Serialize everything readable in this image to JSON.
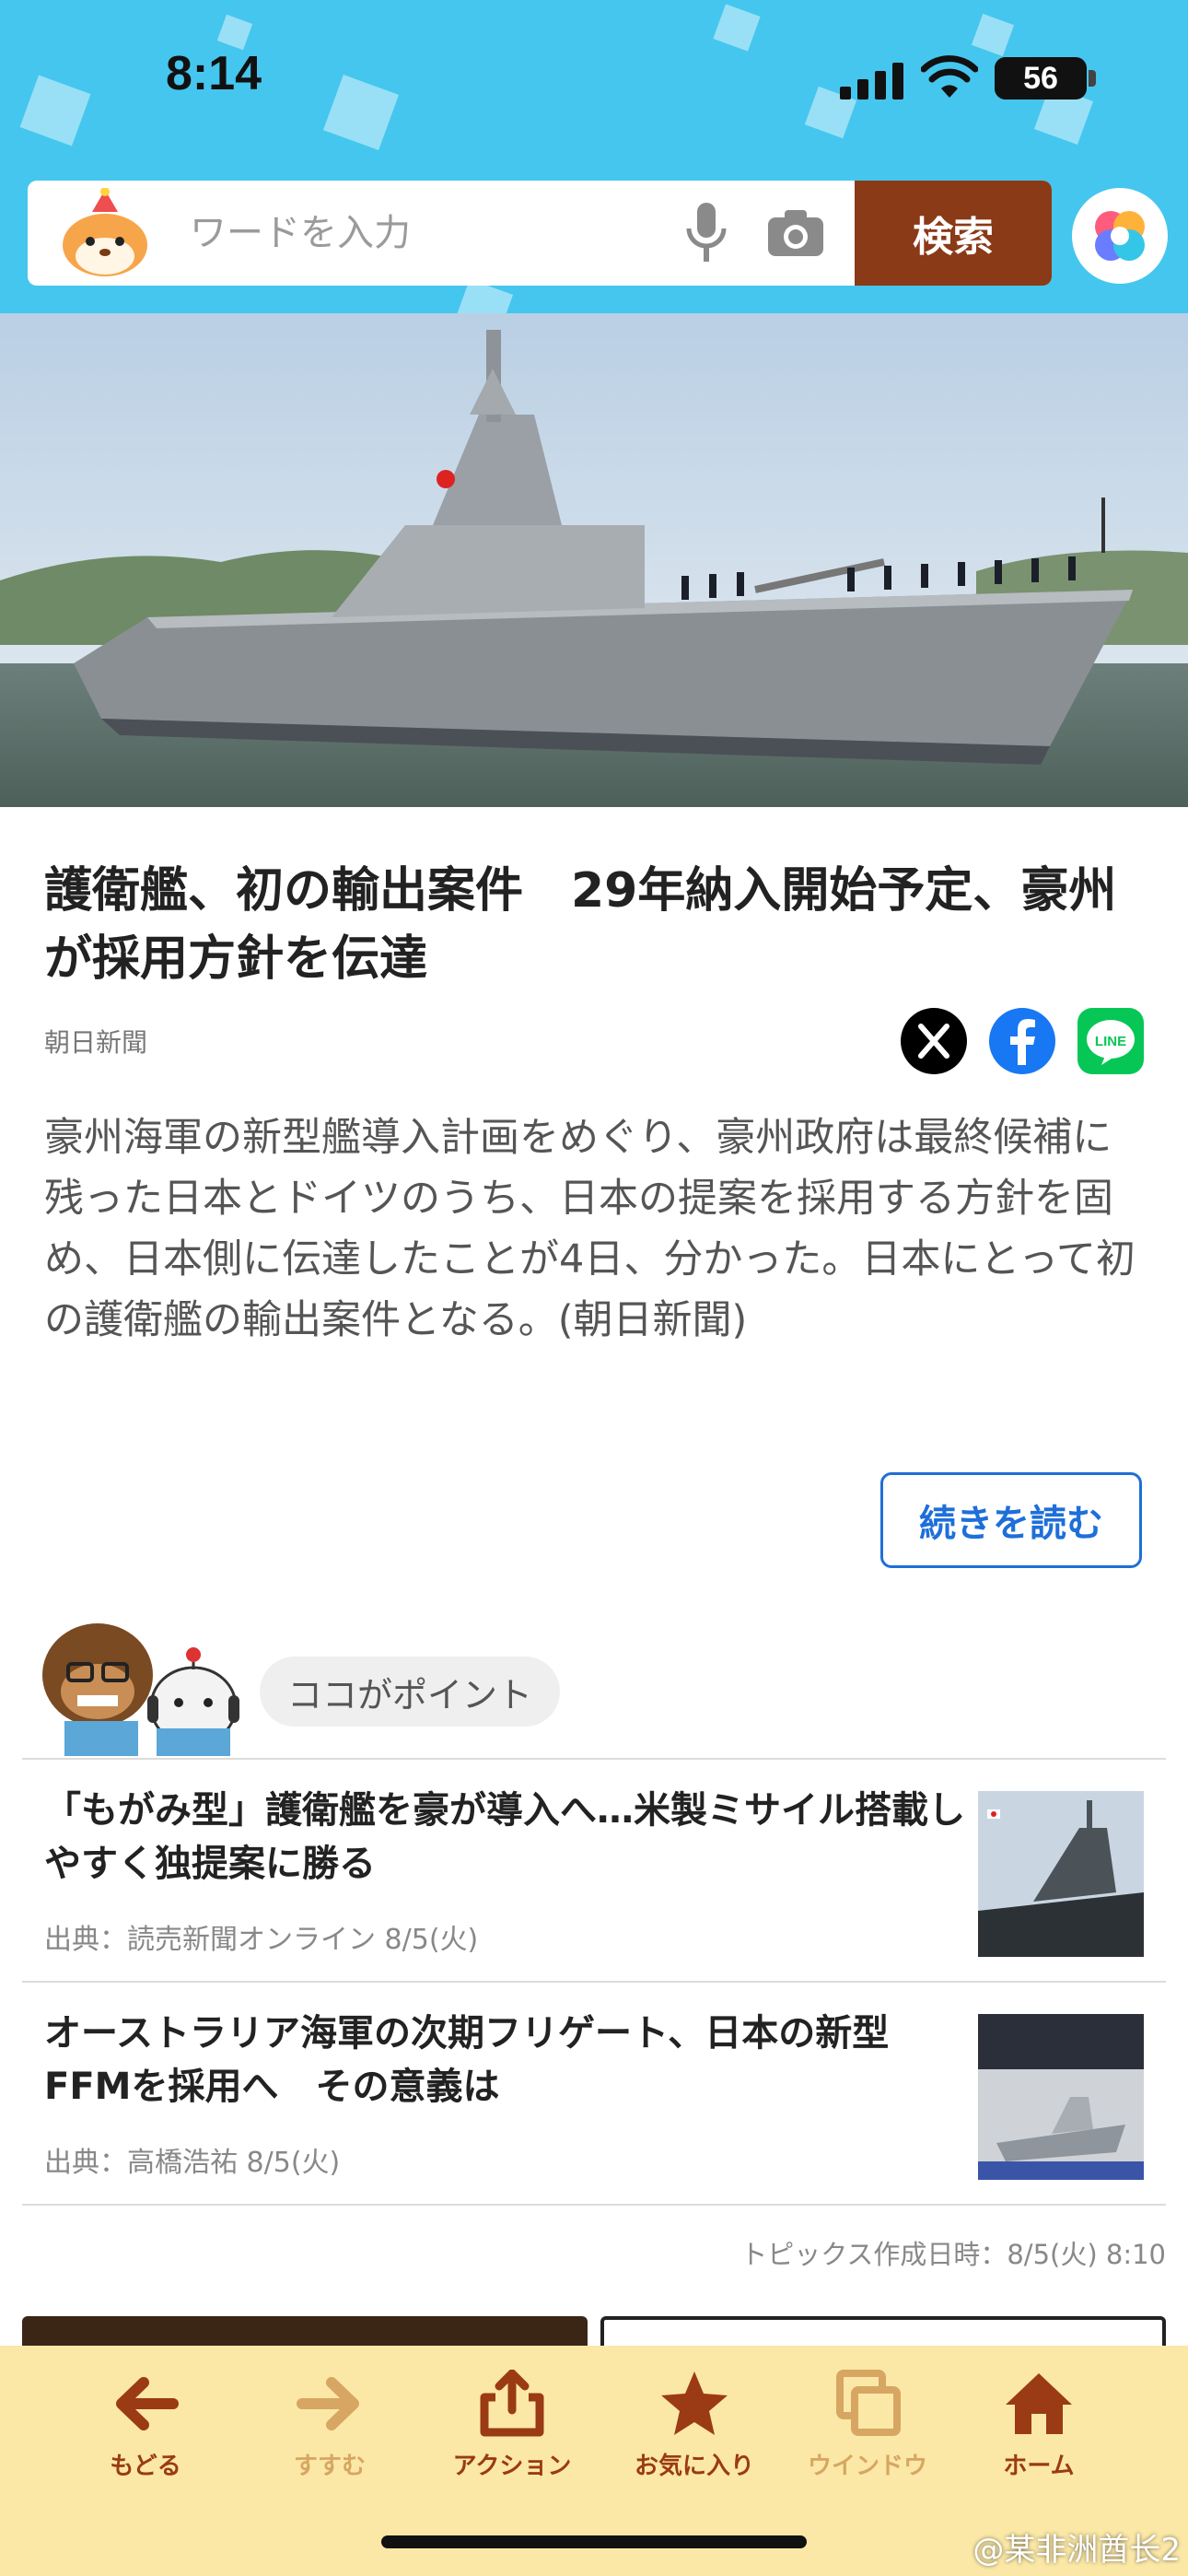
{
  "status_bar": {
    "time": "8:14",
    "battery": "56",
    "icons": [
      "signal-icon",
      "wifi-icon",
      "battery-icon"
    ]
  },
  "search": {
    "placeholder": "ワードを入力",
    "button_label": "検索",
    "icons": [
      "mascot-icon",
      "mic-icon",
      "camera-icon",
      "assistant-icon"
    ]
  },
  "article": {
    "title": "護衛艦、初の輸出案件　29年納入開始予定、豪州が採用方針を伝達",
    "source": "朝日新聞",
    "summary": "豪州海軍の新型艦導入計画をめぐり、豪州政府は最終候補に残った日本とドイツのうち、日本の提案を採用する方針を固め、日本側に伝達したことが4日、分かった。日本にとって初の護衛艦の輸出案件となる。(朝日新聞)",
    "read_more_label": "続きを読む",
    "share_icons": [
      "x-icon",
      "facebook-icon",
      "line-icon"
    ],
    "line_icon_text": "LINE"
  },
  "points": {
    "label": "ココがポイント",
    "items": [
      {
        "title": "「もがみ型」護衛艦を豪が導入へ…米製ミサイル搭載しやすく独提案に勝る",
        "meta": "出典：読売新聞オンライン 8/5(火)"
      },
      {
        "title": "オーストラリア海軍の次期フリゲート、日本の新型FFMを採用へ　その意義は",
        "meta": "出典：高橋浩祐 8/5(火)"
      }
    ],
    "topic_timestamp": "トピックス作成日時：8/5(火) 8:10"
  },
  "toolbar": {
    "items": [
      {
        "label": "もどる",
        "icon": "arrow-left-icon",
        "enabled": true
      },
      {
        "label": "すすむ",
        "icon": "arrow-right-icon",
        "enabled": false
      },
      {
        "label": "アクション",
        "icon": "share-icon",
        "enabled": true
      },
      {
        "label": "お気に入り",
        "icon": "star-icon",
        "enabled": true
      },
      {
        "label": "ウインドウ",
        "icon": "windows-icon",
        "enabled": false
      },
      {
        "label": "ホーム",
        "icon": "home-icon",
        "enabled": true
      }
    ]
  },
  "watermark": "@某非洲酋长2",
  "colors": {
    "header_bg": "#45c6ee",
    "search_button": "#8a3a16",
    "link_blue": "#1e6fd9",
    "toolbar_bg": "#fbe8a6",
    "toolbar_icon": "#9a3b15",
    "toolbar_disabled": "#d7a662"
  }
}
